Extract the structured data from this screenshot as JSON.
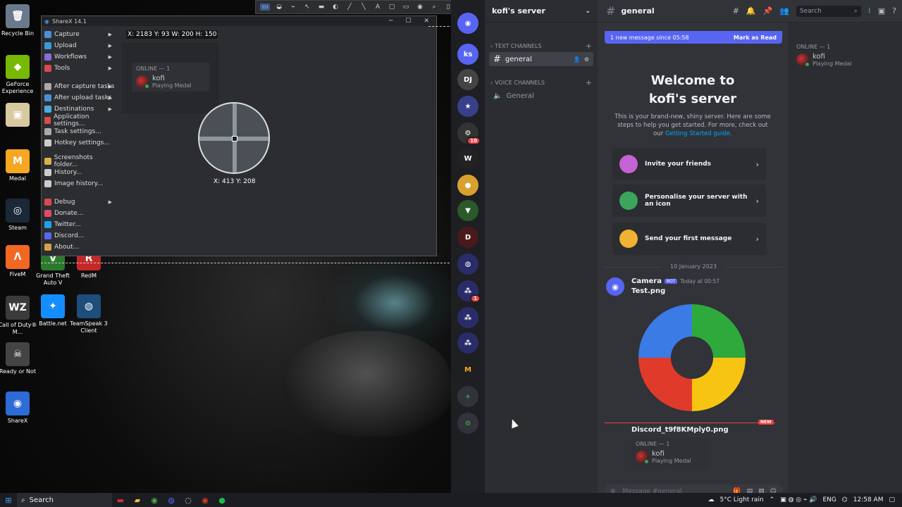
{
  "desktop": {
    "icons": [
      {
        "label": "Recycle Bin",
        "color": "#6a7a8c",
        "glyph": "🗑"
      },
      {
        "label": "GeForce Experience",
        "color": "#76b900",
        "glyph": "◆"
      },
      {
        "label": "",
        "color": "#d8c9a0",
        "glyph": "▣"
      },
      {
        "label": "Medal",
        "color": "#f5a623",
        "glyph": "M"
      },
      {
        "label": "Steam",
        "color": "#1b2838",
        "glyph": "◎"
      },
      {
        "label": "FiveM",
        "color": "#f26822",
        "glyph": "Ʌ"
      },
      {
        "label": "Call of Duty® M...",
        "color": "#3b3b3b",
        "glyph": "WZ"
      },
      {
        "label": "Ready or Not",
        "color": "#444444",
        "glyph": "☠"
      },
      {
        "label": "ShareX",
        "color": "#2d6bd6",
        "glyph": "◉"
      },
      {
        "label": "Grand Theft Auto V",
        "color": "#2b7a2b",
        "glyph": "V"
      },
      {
        "label": "RedM",
        "color": "#c62828",
        "glyph": "R"
      },
      {
        "label": "Battle.net",
        "color": "#148eff",
        "glyph": "✦"
      },
      {
        "label": "TeamSpeak 3 Client",
        "color": "#1d4d7a",
        "glyph": "◍"
      }
    ]
  },
  "sharex": {
    "title": "ShareX 14.1",
    "dims": "X: 2183 Y: 93 W: 200 H: 150",
    "coords": "X: 413 Y: 208",
    "menu": [
      {
        "label": "Capture",
        "sub": true,
        "color": "#4a90d9"
      },
      {
        "label": "Upload",
        "sub": true,
        "color": "#3a9ad9"
      },
      {
        "label": "Workflows",
        "sub": true,
        "color": "#8a6ad9"
      },
      {
        "label": "Tools",
        "sub": true,
        "color": "#d94a4a"
      },
      {
        "sep": true
      },
      {
        "label": "After capture tasks",
        "sub": true,
        "color": "#aaaaaa"
      },
      {
        "label": "After upload tasks",
        "sub": true,
        "color": "#4a90d9"
      },
      {
        "label": "Destinations",
        "sub": true,
        "color": "#4ab0d9"
      },
      {
        "label": "Application settings...",
        "sub": false,
        "color": "#d94a4a"
      },
      {
        "label": "Task settings...",
        "sub": false,
        "color": "#aaaaaa"
      },
      {
        "label": "Hotkey settings...",
        "sub": false,
        "color": "#cccccc"
      },
      {
        "sep": true
      },
      {
        "label": "Screenshots folder...",
        "sub": false,
        "color": "#d9b04a"
      },
      {
        "label": "History...",
        "sub": false,
        "color": "#cccccc"
      },
      {
        "label": "Image history...",
        "sub": false,
        "color": "#cccccc"
      },
      {
        "sep": true
      },
      {
        "label": "Debug",
        "sub": true,
        "color": "#d94a4a"
      },
      {
        "label": "Donate...",
        "sub": false,
        "color": "#e04a6a"
      },
      {
        "label": "Twitter...",
        "sub": false,
        "color": "#1da1f2"
      },
      {
        "label": "Discord...",
        "sub": false,
        "color": "#5865f2"
      },
      {
        "label": "About...",
        "sub": false,
        "color": "#d9a04a"
      }
    ],
    "online_header": "ONLINE — 1",
    "user_name": "kofi",
    "user_activity": "Playing Medal"
  },
  "toolbar_tools": [
    "▭",
    "◒",
    "⌁",
    "↖",
    "▬",
    "◐",
    "╱",
    "╲",
    "A",
    "▢",
    "▭",
    "◉",
    "⌕",
    "▯",
    "◌",
    "⌂",
    "✎",
    "▦",
    "⋯",
    "⬚",
    "▾",
    "⌗",
    "▾",
    "⚙",
    "▾"
  ],
  "discord": {
    "server_name": "kofi's server",
    "text_channels_label": "TEXT CHANNELS",
    "voice_channels_label": "VOICE CHANNELS",
    "text_channel": "general",
    "voice_channel": "General",
    "channel_title": "general",
    "search_placeholder": "Search",
    "new_messages": "1 new message since 05:58",
    "mark_read": "Mark as Read",
    "welcome_line1": "Welcome to",
    "welcome_line2": "kofi's server",
    "welcome_desc": "This is your brand-new, shiny server. Here are some steps to help you get started. For more, check out our",
    "welcome_link": "Getting Started guide.",
    "cards": [
      {
        "label": "Invite your friends",
        "color": "#c462d6"
      },
      {
        "label": "Personalise your server with an icon",
        "color": "#3ba55d"
      },
      {
        "label": "Send your first message",
        "color": "#f0b232"
      }
    ],
    "date_sep": "10 January 2023",
    "author": "Camera",
    "bot_tag": "BOT",
    "timestamp": "Today at 00:57",
    "file1": "Test.png",
    "file2": "Discord_t9f8KMply0.png",
    "new_tag": "NEW",
    "message_placeholder": "Message #general",
    "online_header": "ONLINE — 1",
    "member_name": "kofi",
    "member_activity": "Playing Medal",
    "server_abbrev": "ks",
    "servers": [
      {
        "color": "#5865f2",
        "glyph": "◉"
      },
      {
        "color": "#5865f2",
        "glyph": "ks"
      },
      {
        "color": "#444",
        "glyph": "DJ"
      },
      {
        "color": "#3a3f8a",
        "glyph": "★"
      },
      {
        "color": "#333",
        "glyph": "⚙",
        "badge": "10"
      },
      {
        "color": "#222",
        "glyph": "W"
      },
      {
        "color": "#d9a030",
        "glyph": "●"
      },
      {
        "color": "#2a5a2a",
        "glyph": "▼"
      },
      {
        "color": "#4a1a1a",
        "glyph": "D"
      },
      {
        "color": "#2a2c6a",
        "glyph": "◍"
      },
      {
        "color": "#2a2c6a",
        "glyph": "⁂",
        "badge": "1"
      },
      {
        "color": "#2a2c6a",
        "glyph": "⁂"
      },
      {
        "color": "#2a2c6a",
        "glyph": "⁂"
      },
      {
        "color": "#1e1f22",
        "glyph": "M"
      },
      {
        "color": "#313338",
        "glyph": "+"
      },
      {
        "color": "#313338",
        "glyph": "⊘"
      }
    ]
  },
  "taskbar": {
    "search": "Search",
    "weather": "5°C  Light rain",
    "lang": "ENG",
    "time": "12:58 AM"
  }
}
